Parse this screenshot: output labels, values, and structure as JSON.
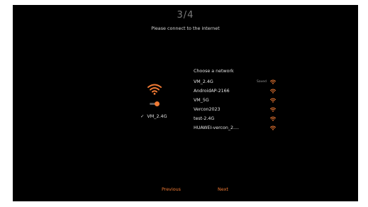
{
  "header": {
    "step": "3/4",
    "subtitle": "Please connect to the internet"
  },
  "status": {
    "wifi_icon": "wifi-icon",
    "toggle_on": true,
    "connected_network": "VM_2.4G",
    "accent_color": "#f07a34"
  },
  "networks": {
    "title": "Choose a network",
    "items": [
      {
        "name": "VM_2.4G",
        "badge": "Saved"
      },
      {
        "name": "AndroidAP-2166",
        "badge": ""
      },
      {
        "name": "VM_5G",
        "badge": ""
      },
      {
        "name": "Vercon2023",
        "badge": ""
      },
      {
        "name": "test-2.4G",
        "badge": ""
      },
      {
        "name": "HUAWEI-vercon_2....",
        "badge": ""
      }
    ]
  },
  "footer": {
    "previous": "Previous",
    "next": "Next"
  }
}
